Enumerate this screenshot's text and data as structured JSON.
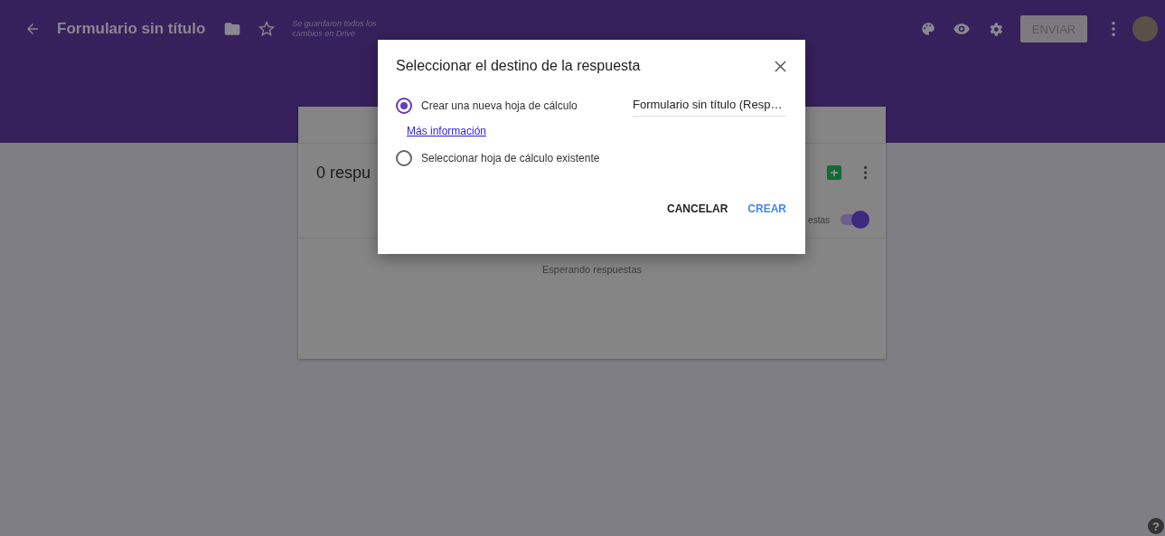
{
  "header": {
    "title": "Formulario sin título",
    "save_status": "Se guardaron todos los cambios en Drive",
    "send_button": "ENVIAR"
  },
  "card": {
    "title": "0 respu",
    "toggle_label": "estas",
    "toggle_on": true,
    "empty_message": "Esperando respuestas"
  },
  "dialog": {
    "title": "Seleccionar el destino de la respuesta",
    "options": [
      {
        "label": "Crear una nueva hoja de cálculo",
        "selected": true
      },
      {
        "label": "Seleccionar hoja de cálculo existente",
        "selected": false
      }
    ],
    "sheet_name": "Formulario sin título (Resp…",
    "link": "Más información",
    "buttons": [
      {
        "label": "CANCELAR",
        "kind": "secondary"
      },
      {
        "label": "CREAR",
        "kind": "primary"
      }
    ]
  },
  "help_icon": "?"
}
